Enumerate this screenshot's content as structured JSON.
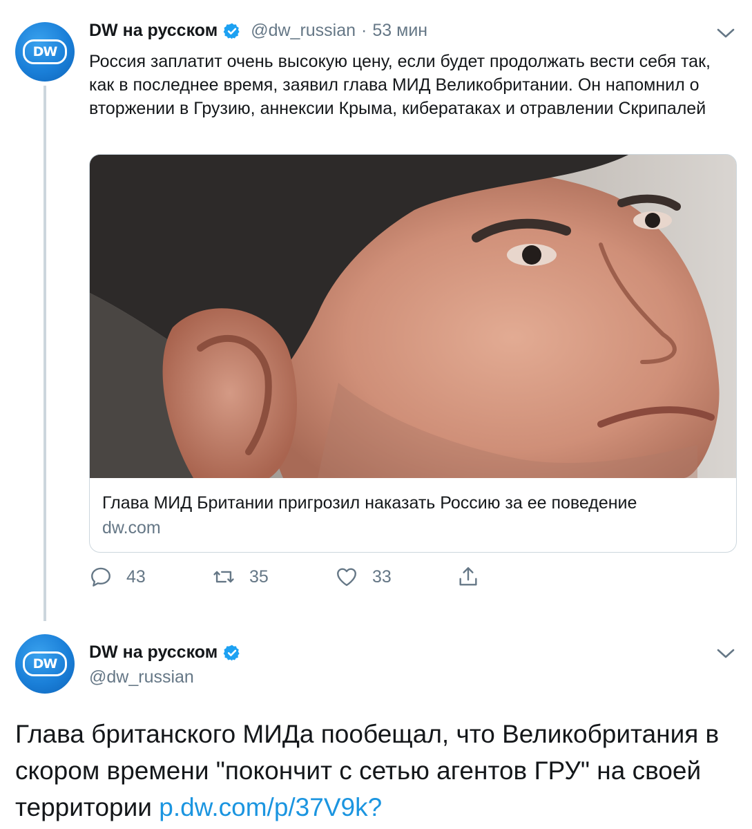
{
  "tweet1": {
    "author_name": "DW на русском",
    "handle": "@dw_russian",
    "separator": "·",
    "time": "53 мин",
    "text": "Россия заплатит очень высокую цену, если будет продолжать вести себя так, как в последнее время, заявил глава МИД Великобритании. Он напомнил о вторжении в Грузию, аннексии Крыма, кибератаках и отравлении Скрипалей",
    "card": {
      "title": "Глава МИД Британии пригрозил наказать Россию за ее поведение",
      "domain": "dw.com"
    },
    "actions": {
      "replies": "43",
      "retweets": "35",
      "likes": "33"
    }
  },
  "tweet2": {
    "author_name": "DW на русском",
    "handle": "@dw_russian",
    "text": "Глава британского МИДа пообещал, что Великобритания в скором времени \"покончит с сетью агентов ГРУ\" на своей территории",
    "link": "p.dw.com/p/37V9k?"
  },
  "avatar_label": "DW",
  "icons": {
    "verified": "verified-badge-icon",
    "caret": "chevron-down-icon",
    "reply": "reply-icon",
    "retweet": "retweet-icon",
    "like": "heart-icon",
    "share": "share-icon"
  },
  "colors": {
    "accent": "#1da1f2",
    "link": "#1b95e0",
    "secondary_text": "#657786",
    "primary_text": "#14171a",
    "avatar_blue": "#1a7fd8"
  }
}
